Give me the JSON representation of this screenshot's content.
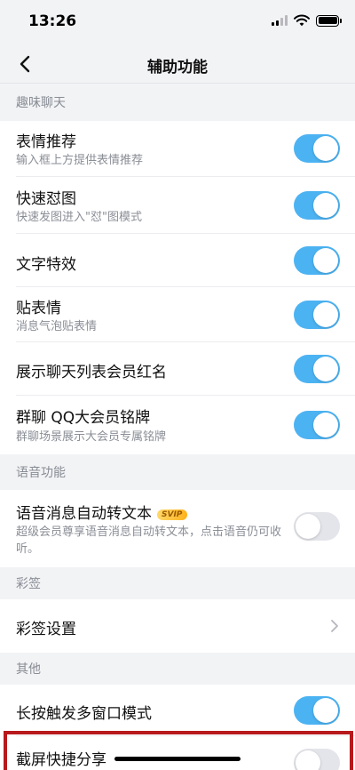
{
  "status_bar": {
    "time": "13:26"
  },
  "nav": {
    "title": "辅助功能"
  },
  "sections": {
    "fun_chat": "趣味聊天",
    "voice": "语音功能",
    "caiqian": "彩签",
    "other": "其他"
  },
  "settings": {
    "emoji_recommend": {
      "title": "表情推荐",
      "subtitle": "输入框上方提供表情推荐",
      "enabled": true
    },
    "quick_sticker": {
      "title": "快速怼图",
      "subtitle": "快速发图进入\"怼\"图模式",
      "enabled": true
    },
    "text_effects": {
      "title": "文字特效",
      "enabled": true
    },
    "sticker_reply": {
      "title": "贴表情",
      "subtitle": "消息气泡贴表情",
      "enabled": true
    },
    "vip_red_name": {
      "title": "展示聊天列表会员红名",
      "enabled": true
    },
    "group_qq_badge": {
      "title": "群聊 QQ大会员铭牌",
      "subtitle": "群聊场景展示大会员专属铭牌",
      "enabled": true
    },
    "voice_to_text": {
      "title": "语音消息自动转文本",
      "badge": "SVIP",
      "subtitle": "超级会员尊享语音消息自动转文本，点击语音仍可收听。",
      "enabled": false
    },
    "caiqian_settings": {
      "title": "彩签设置"
    },
    "long_press_multiwindow": {
      "title": "长按触发多窗口模式",
      "enabled": true
    },
    "screenshot_share": {
      "title": "截屏快捷分享",
      "enabled": false
    }
  },
  "colors": {
    "toggle_on": "#4cb3f3",
    "toggle_off": "#e4e5ea",
    "highlight": "#b7191c",
    "background": "#f2f3f5"
  }
}
